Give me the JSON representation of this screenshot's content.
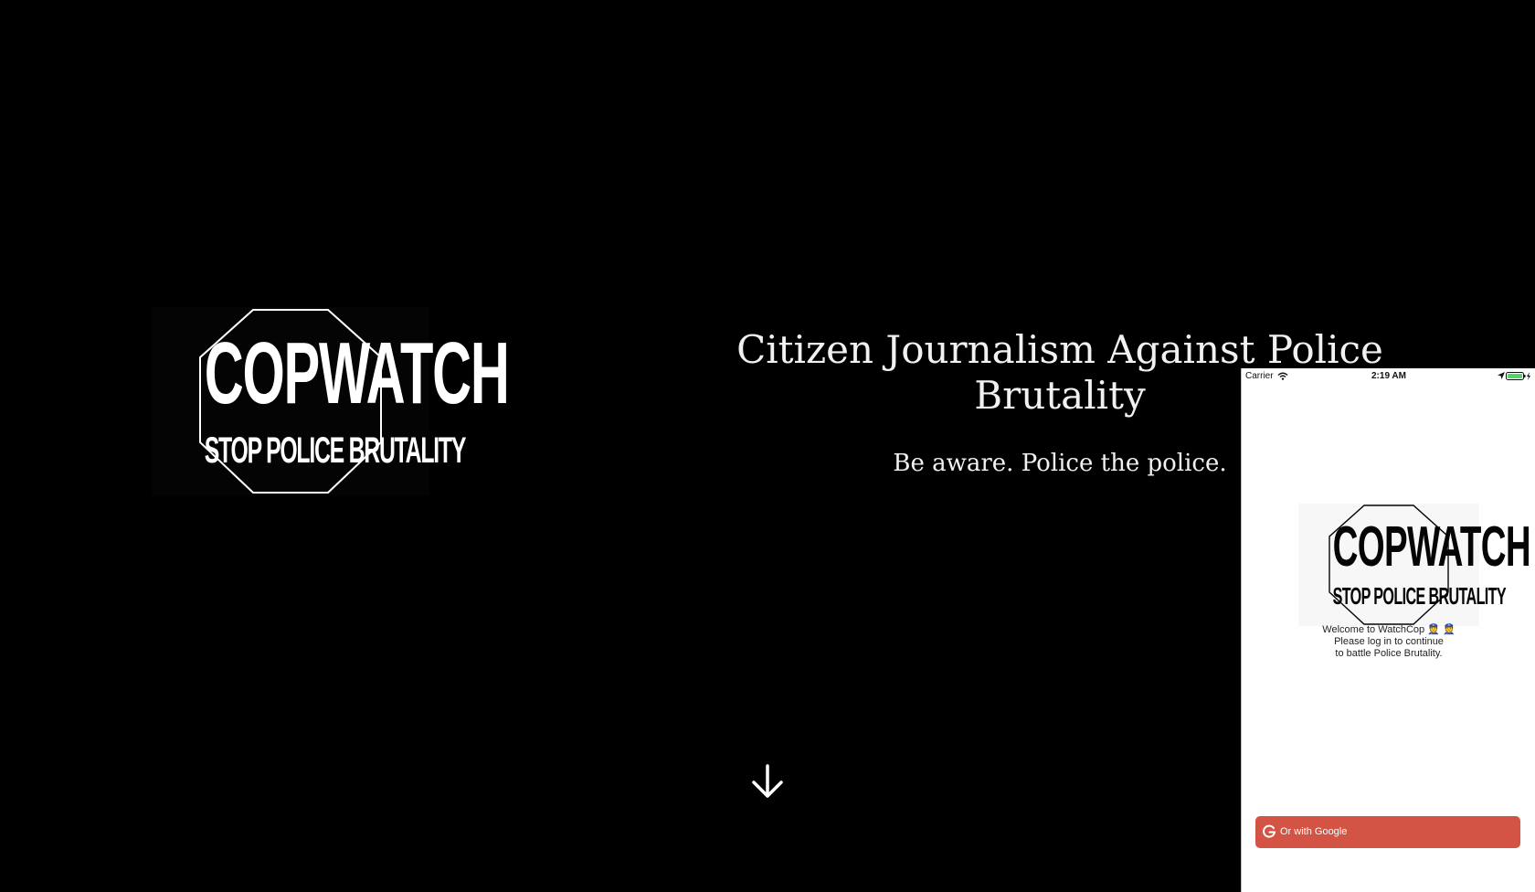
{
  "hero": {
    "logo": {
      "word": "COPWATCH",
      "tagline": "STOP POLICE BRUTALITY"
    },
    "title": "Citizen Journalism Against Police Brutality",
    "subtitle": "Be aware. Police the police.",
    "scroll_icon": "arrow-down-icon"
  },
  "phone": {
    "status_bar": {
      "carrier": "Carrier",
      "time": "2:19 AM",
      "icons": [
        "wifi-icon",
        "location-arrow-icon",
        "battery-charging-icon"
      ]
    },
    "logo": {
      "word": "COPWATCH",
      "tagline": "STOP POLICE BRUTALITY"
    },
    "welcome_lines": [
      "Welcome to WatchCop 👮 👮",
      "Please log in to continue",
      "to battle Police Brutality."
    ],
    "google_button": {
      "label": "Or with Google",
      "icon": "google-g-icon",
      "color": "#d35444"
    }
  },
  "colors": {
    "background": "#000000",
    "hero_text": "#f1f1f1",
    "phone_background": "#ffffff"
  }
}
